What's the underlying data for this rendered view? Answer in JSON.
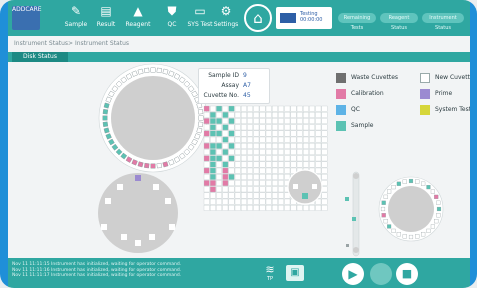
{
  "toolbar": {
    "logo": "ADDCARE",
    "items": [
      {
        "label": "Sample",
        "icon": "pencil-icon"
      },
      {
        "label": "Result",
        "icon": "document-icon"
      },
      {
        "label": "Reagent",
        "icon": "flask-icon"
      },
      {
        "label": "QC",
        "icon": "shield-icon"
      },
      {
        "label": "SYS Test",
        "icon": "monitor-icon"
      },
      {
        "label": "Settings",
        "icon": "gear-icon"
      }
    ],
    "home_icon": "home-icon",
    "status_text": "Testing",
    "status_sub": "00:00:00",
    "pills": [
      "Remaining Tests",
      "Reagent Status",
      "Instrument Status"
    ]
  },
  "breadcrumb": "Instrument Status> Instrument Status",
  "tab_label": "Disk Status",
  "info": {
    "sample_id_label": "Sample ID",
    "sample_id_value": "9",
    "assay_label": "Assay",
    "assay_value": "A7",
    "cuvette_label": "Cuvette No.",
    "cuvette_value": "45"
  },
  "legend": [
    {
      "label": "Waste Cuvettes",
      "color": "#6f6f6f"
    },
    {
      "label": "New Cuvette",
      "color": "#ffffff"
    },
    {
      "label": "Calibration",
      "color": "#e27aa6"
    },
    {
      "label": "Prime",
      "color": "#9b8ad1"
    },
    {
      "label": "QC",
      "color": "#5eb3e6"
    },
    {
      "label": "System Test",
      "color": "#d6d63a"
    },
    {
      "label": "Sample",
      "color": "#5cc2b3"
    }
  ],
  "log_lines": [
    "Nov 11 11:11:15 Instrument has initialized, waiting for operator command.",
    "Nov 11 11:11:16 Instrument has initialized, waiting for operator command.",
    "Nov 11 11:11:17 Instrument has initialized, waiting for operator command."
  ],
  "bottom": {
    "wifi_icon": "wifi-icon",
    "wifi_label": "TP",
    "folder_icon": "folder-icon",
    "play_icon": "play-icon",
    "pause_icon": "pause-icon",
    "stop_icon": "stop-icon"
  },
  "colors": {
    "teal": "#2fa7a1",
    "sample": "#5cc2b3",
    "calibration": "#e27aa6",
    "qc": "#5eb3e6",
    "prime": "#9b8ad1",
    "frame": "#1f8fd8"
  }
}
